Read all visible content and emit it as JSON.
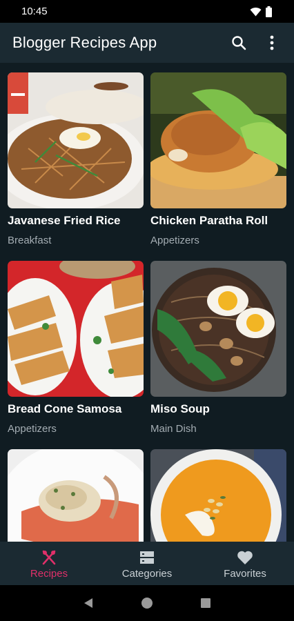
{
  "status_bar": {
    "time": "10:45"
  },
  "app_bar": {
    "title": "Blogger Recipes App",
    "icons": [
      "search-icon",
      "more-vert-icon"
    ]
  },
  "recipes": [
    {
      "title": "Javanese Fried Rice",
      "category": "Breakfast"
    },
    {
      "title": "Chicken Paratha Roll",
      "category": "Appetizers"
    },
    {
      "title": "Bread Cone Samosa",
      "category": "Appetizers"
    },
    {
      "title": "Miso Soup",
      "category": "Main Dish"
    },
    {
      "title": "",
      "category": ""
    },
    {
      "title": "",
      "category": ""
    }
  ],
  "bottom_nav": {
    "items": [
      {
        "label": "Recipes",
        "icon": "fork-knife-icon",
        "active": true
      },
      {
        "label": "Categories",
        "icon": "categories-icon",
        "active": false
      },
      {
        "label": "Favorites",
        "icon": "heart-icon",
        "active": false
      }
    ]
  },
  "colors": {
    "background": "#101c22",
    "app_bar": "#1b2a32",
    "accent": "#e0306a",
    "secondary_text": "#a4adb3"
  }
}
